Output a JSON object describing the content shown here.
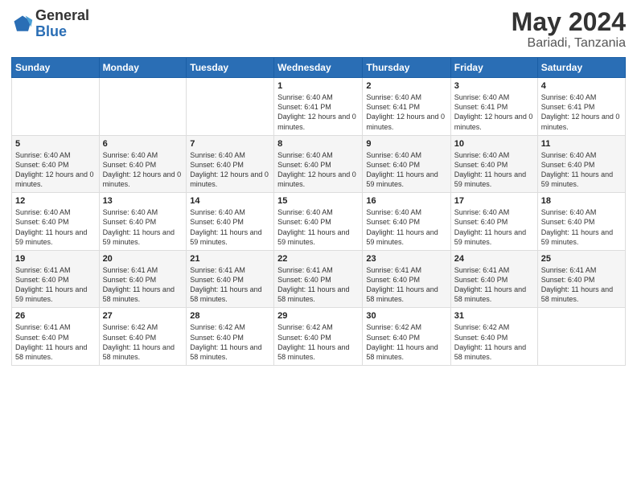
{
  "logo": {
    "general": "General",
    "blue": "Blue"
  },
  "title": "May 2024",
  "location": "Bariadi, Tanzania",
  "headers": [
    "Sunday",
    "Monday",
    "Tuesday",
    "Wednesday",
    "Thursday",
    "Friday",
    "Saturday"
  ],
  "weeks": [
    [
      {
        "day": "",
        "sunrise": "",
        "sunset": "",
        "daylight": ""
      },
      {
        "day": "",
        "sunrise": "",
        "sunset": "",
        "daylight": ""
      },
      {
        "day": "",
        "sunrise": "",
        "sunset": "",
        "daylight": ""
      },
      {
        "day": "1",
        "sunrise": "Sunrise: 6:40 AM",
        "sunset": "Sunset: 6:41 PM",
        "daylight": "Daylight: 12 hours and 0 minutes."
      },
      {
        "day": "2",
        "sunrise": "Sunrise: 6:40 AM",
        "sunset": "Sunset: 6:41 PM",
        "daylight": "Daylight: 12 hours and 0 minutes."
      },
      {
        "day": "3",
        "sunrise": "Sunrise: 6:40 AM",
        "sunset": "Sunset: 6:41 PM",
        "daylight": "Daylight: 12 hours and 0 minutes."
      },
      {
        "day": "4",
        "sunrise": "Sunrise: 6:40 AM",
        "sunset": "Sunset: 6:41 PM",
        "daylight": "Daylight: 12 hours and 0 minutes."
      }
    ],
    [
      {
        "day": "5",
        "sunrise": "Sunrise: 6:40 AM",
        "sunset": "Sunset: 6:40 PM",
        "daylight": "Daylight: 12 hours and 0 minutes."
      },
      {
        "day": "6",
        "sunrise": "Sunrise: 6:40 AM",
        "sunset": "Sunset: 6:40 PM",
        "daylight": "Daylight: 12 hours and 0 minutes."
      },
      {
        "day": "7",
        "sunrise": "Sunrise: 6:40 AM",
        "sunset": "Sunset: 6:40 PM",
        "daylight": "Daylight: 12 hours and 0 minutes."
      },
      {
        "day": "8",
        "sunrise": "Sunrise: 6:40 AM",
        "sunset": "Sunset: 6:40 PM",
        "daylight": "Daylight: 12 hours and 0 minutes."
      },
      {
        "day": "9",
        "sunrise": "Sunrise: 6:40 AM",
        "sunset": "Sunset: 6:40 PM",
        "daylight": "Daylight: 11 hours and 59 minutes."
      },
      {
        "day": "10",
        "sunrise": "Sunrise: 6:40 AM",
        "sunset": "Sunset: 6:40 PM",
        "daylight": "Daylight: 11 hours and 59 minutes."
      },
      {
        "day": "11",
        "sunrise": "Sunrise: 6:40 AM",
        "sunset": "Sunset: 6:40 PM",
        "daylight": "Daylight: 11 hours and 59 minutes."
      }
    ],
    [
      {
        "day": "12",
        "sunrise": "Sunrise: 6:40 AM",
        "sunset": "Sunset: 6:40 PM",
        "daylight": "Daylight: 11 hours and 59 minutes."
      },
      {
        "day": "13",
        "sunrise": "Sunrise: 6:40 AM",
        "sunset": "Sunset: 6:40 PM",
        "daylight": "Daylight: 11 hours and 59 minutes."
      },
      {
        "day": "14",
        "sunrise": "Sunrise: 6:40 AM",
        "sunset": "Sunset: 6:40 PM",
        "daylight": "Daylight: 11 hours and 59 minutes."
      },
      {
        "day": "15",
        "sunrise": "Sunrise: 6:40 AM",
        "sunset": "Sunset: 6:40 PM",
        "daylight": "Daylight: 11 hours and 59 minutes."
      },
      {
        "day": "16",
        "sunrise": "Sunrise: 6:40 AM",
        "sunset": "Sunset: 6:40 PM",
        "daylight": "Daylight: 11 hours and 59 minutes."
      },
      {
        "day": "17",
        "sunrise": "Sunrise: 6:40 AM",
        "sunset": "Sunset: 6:40 PM",
        "daylight": "Daylight: 11 hours and 59 minutes."
      },
      {
        "day": "18",
        "sunrise": "Sunrise: 6:40 AM",
        "sunset": "Sunset: 6:40 PM",
        "daylight": "Daylight: 11 hours and 59 minutes."
      }
    ],
    [
      {
        "day": "19",
        "sunrise": "Sunrise: 6:41 AM",
        "sunset": "Sunset: 6:40 PM",
        "daylight": "Daylight: 11 hours and 59 minutes."
      },
      {
        "day": "20",
        "sunrise": "Sunrise: 6:41 AM",
        "sunset": "Sunset: 6:40 PM",
        "daylight": "Daylight: 11 hours and 58 minutes."
      },
      {
        "day": "21",
        "sunrise": "Sunrise: 6:41 AM",
        "sunset": "Sunset: 6:40 PM",
        "daylight": "Daylight: 11 hours and 58 minutes."
      },
      {
        "day": "22",
        "sunrise": "Sunrise: 6:41 AM",
        "sunset": "Sunset: 6:40 PM",
        "daylight": "Daylight: 11 hours and 58 minutes."
      },
      {
        "day": "23",
        "sunrise": "Sunrise: 6:41 AM",
        "sunset": "Sunset: 6:40 PM",
        "daylight": "Daylight: 11 hours and 58 minutes."
      },
      {
        "day": "24",
        "sunrise": "Sunrise: 6:41 AM",
        "sunset": "Sunset: 6:40 PM",
        "daylight": "Daylight: 11 hours and 58 minutes."
      },
      {
        "day": "25",
        "sunrise": "Sunrise: 6:41 AM",
        "sunset": "Sunset: 6:40 PM",
        "daylight": "Daylight: 11 hours and 58 minutes."
      }
    ],
    [
      {
        "day": "26",
        "sunrise": "Sunrise: 6:41 AM",
        "sunset": "Sunset: 6:40 PM",
        "daylight": "Daylight: 11 hours and 58 minutes."
      },
      {
        "day": "27",
        "sunrise": "Sunrise: 6:42 AM",
        "sunset": "Sunset: 6:40 PM",
        "daylight": "Daylight: 11 hours and 58 minutes."
      },
      {
        "day": "28",
        "sunrise": "Sunrise: 6:42 AM",
        "sunset": "Sunset: 6:40 PM",
        "daylight": "Daylight: 11 hours and 58 minutes."
      },
      {
        "day": "29",
        "sunrise": "Sunrise: 6:42 AM",
        "sunset": "Sunset: 6:40 PM",
        "daylight": "Daylight: 11 hours and 58 minutes."
      },
      {
        "day": "30",
        "sunrise": "Sunrise: 6:42 AM",
        "sunset": "Sunset: 6:40 PM",
        "daylight": "Daylight: 11 hours and 58 minutes."
      },
      {
        "day": "31",
        "sunrise": "Sunrise: 6:42 AM",
        "sunset": "Sunset: 6:40 PM",
        "daylight": "Daylight: 11 hours and 58 minutes."
      },
      {
        "day": "",
        "sunrise": "",
        "sunset": "",
        "daylight": ""
      }
    ]
  ]
}
